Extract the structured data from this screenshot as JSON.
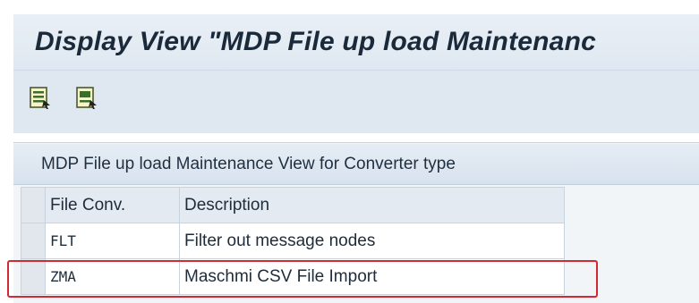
{
  "header": {
    "title": "Display View \"MDP File up load Maintenanc"
  },
  "toolbar": {
    "buttons": [
      {
        "icon": "select-all-icon"
      },
      {
        "icon": "select-block-icon"
      }
    ]
  },
  "panel": {
    "title": "MDP File up load Maintenance View for Converter type",
    "columns": [
      "File Conv.",
      "Description"
    ],
    "rows": [
      {
        "file_conv": "FLT",
        "description": "Filter out message nodes"
      },
      {
        "file_conv": "ZMA",
        "description": "Maschmi CSV File Import",
        "highlighted": true
      }
    ]
  },
  "colors": {
    "highlight": "#d12a35",
    "title_bar": "#e9eff6",
    "toolbar": "#dfe8f1"
  }
}
